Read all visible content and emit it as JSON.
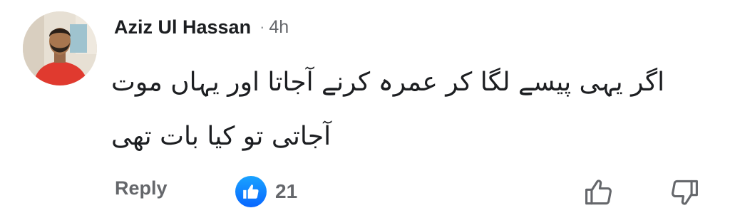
{
  "comment": {
    "author": "Aziz Ul Hassan",
    "separator": "·",
    "time": "4h",
    "body_lines": [
      "اگر یہی پیسے لگا کر عمرہ کرنے آجاتا اور یہاں موت",
      "آجاتی تو کیا بات تھی"
    ],
    "actions": {
      "reply_label": "Reply",
      "reaction_count": "21"
    }
  },
  "icons": {
    "avatar": "profile-photo",
    "like_badge": "thumbs-up-icon",
    "upvote": "thumbs-up-outline-icon",
    "downvote": "thumbs-down-outline-icon"
  },
  "colors": {
    "like_blue": "#0866ff",
    "secondary_text": "#65676b",
    "primary_text": "#1c1e21"
  }
}
